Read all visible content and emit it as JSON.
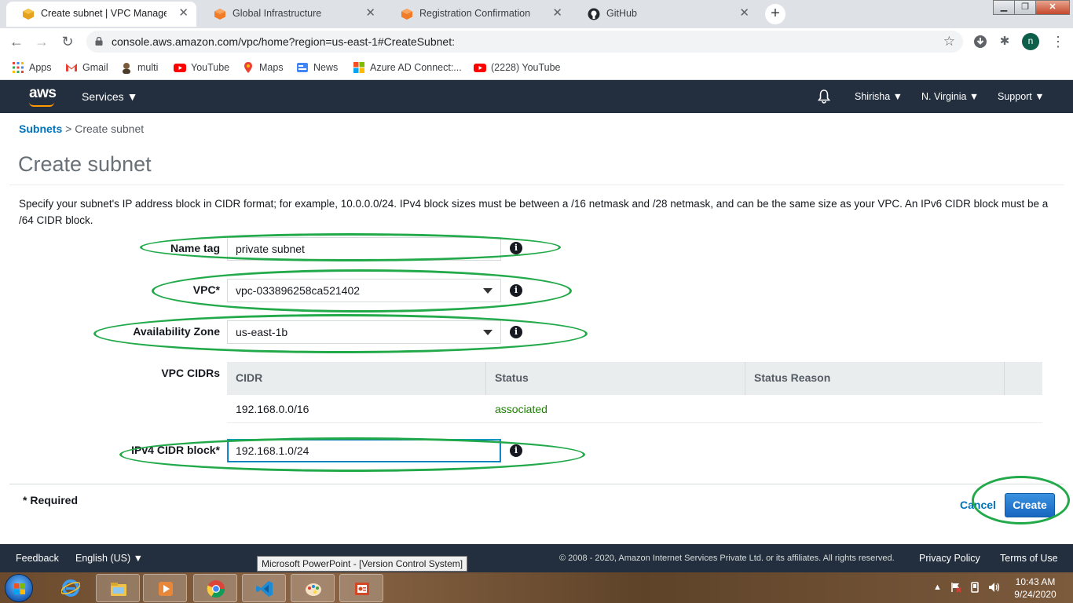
{
  "browser": {
    "tabs": [
      {
        "title": "Create subnet | VPC Managemen",
        "active": true
      },
      {
        "title": "Global Infrastructure",
        "active": false
      },
      {
        "title": "Registration Confirmation",
        "active": false
      },
      {
        "title": "GitHub",
        "active": false
      }
    ],
    "new_tab_label": "+",
    "url": "console.aws.amazon.com/vpc/home?region=us-east-1#CreateSubnet:",
    "profile_initial": "n",
    "bookmarks": [
      {
        "label": "Apps",
        "icon": "apps-grid-icon"
      },
      {
        "label": "Gmail",
        "icon": "gmail-icon"
      },
      {
        "label": "multi",
        "icon": "multi-icon"
      },
      {
        "label": "YouTube",
        "icon": "youtube-icon"
      },
      {
        "label": "Maps",
        "icon": "maps-icon"
      },
      {
        "label": "News",
        "icon": "news-icon"
      },
      {
        "label": "Azure AD Connect:...",
        "icon": "microsoft-icon"
      },
      {
        "label": "(2228) YouTube",
        "icon": "youtube-icon"
      }
    ]
  },
  "aws_nav": {
    "logo": "aws",
    "services": "Services",
    "user": "Shirisha",
    "region": "N. Virginia",
    "support": "Support"
  },
  "breadcrumb": {
    "link": "Subnets",
    "separator": ">",
    "current": "Create subnet"
  },
  "page": {
    "title": "Create subnet",
    "description": "Specify your subnet's IP address block in CIDR format; for example, 10.0.0.0/24. IPv4 block sizes must be between a /16 netmask and /28 netmask, and can be the same size as your VPC. An IPv6 CIDR block must be a /64 CIDR block."
  },
  "form": {
    "name_tag": {
      "label": "Name tag",
      "value": "private subnet"
    },
    "vpc": {
      "label": "VPC*",
      "value": "vpc-033896258ca521402"
    },
    "availability_zone": {
      "label": "Availability Zone",
      "value": "us-east-1b"
    },
    "vpc_cidrs": {
      "label": "VPC CIDRs",
      "columns": [
        "CIDR",
        "Status",
        "Status Reason"
      ],
      "rows": [
        {
          "cidr": "192.168.0.0/16",
          "status": "associated",
          "reason": ""
        }
      ]
    },
    "ipv4_cidr": {
      "label": "IPv4 CIDR block*",
      "value": "192.168.1.0/24"
    },
    "required_note": "* Required",
    "cancel": "Cancel",
    "create": "Create",
    "info_glyph": "i"
  },
  "footer": {
    "feedback": "Feedback",
    "language": "English (US)",
    "copyright": "© 2008 - 2020, Amazon Internet Services Private Ltd. or its affiliates. All rights reserved.",
    "privacy": "Privacy Policy",
    "terms": "Terms of Use"
  },
  "tooltip": "Microsoft PowerPoint - [Version Control System]",
  "taskbar": {
    "time": "10:43 AM",
    "date": "9/24/2020",
    "apps": [
      "internet-explorer-icon",
      "file-explorer-icon",
      "media-player-icon",
      "chrome-icon",
      "vscode-icon",
      "paint-icon",
      "powerpoint-icon"
    ]
  },
  "colors": {
    "aws_nav_bg": "#232f3e",
    "link": "#0073bb",
    "status_ok": "#1d8102",
    "annotation": "#22a94a",
    "create_button": "#1766c0"
  }
}
